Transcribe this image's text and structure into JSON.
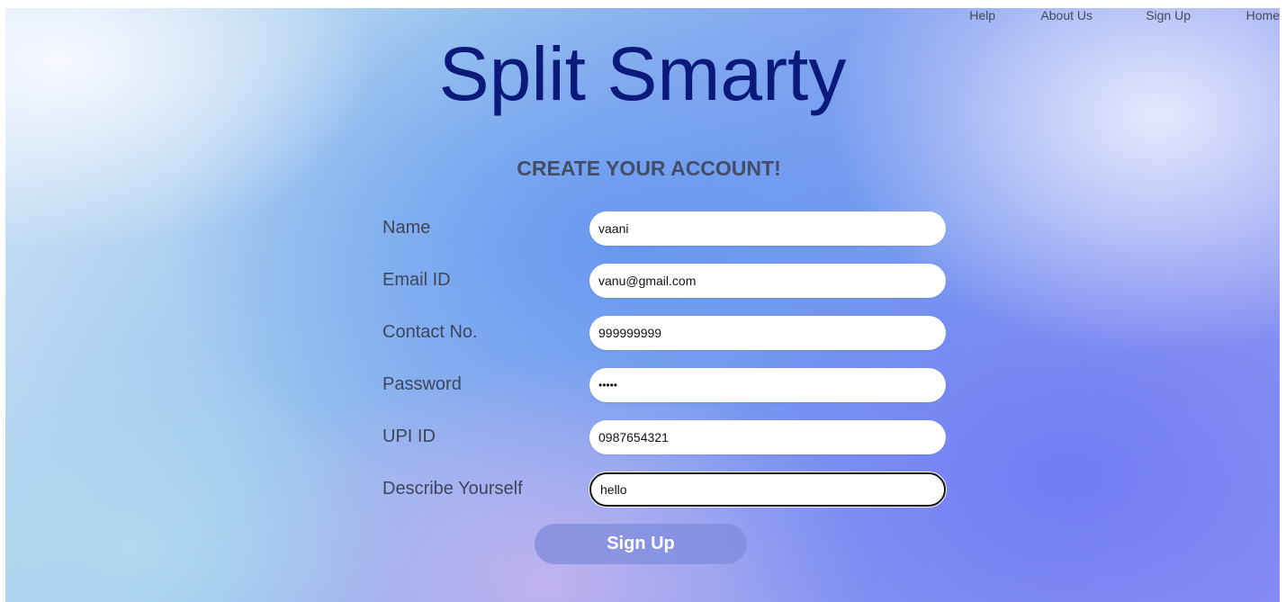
{
  "nav": {
    "items": [
      {
        "label": "Help"
      },
      {
        "label": "About Us"
      },
      {
        "label": "Sign Up"
      },
      {
        "label": "Home"
      }
    ]
  },
  "header": {
    "title": "Split Smarty",
    "subtitle": "CREATE YOUR ACCOUNT!"
  },
  "form": {
    "fields": [
      {
        "label": "Name",
        "value": "vaani"
      },
      {
        "label": "Email ID",
        "value": "vanu@gmail.com"
      },
      {
        "label": "Contact No.",
        "value": "999999999"
      },
      {
        "label": "Password",
        "value": "•••••"
      },
      {
        "label": "UPI ID",
        "value": "0987654321"
      },
      {
        "label": "Describe Yourself",
        "value": "hello"
      }
    ],
    "submit_label": "Sign Up"
  },
  "colors": {
    "title": "#0b1a7a",
    "subtitle": "#444d66",
    "button_bg": "#7d8cdc"
  }
}
